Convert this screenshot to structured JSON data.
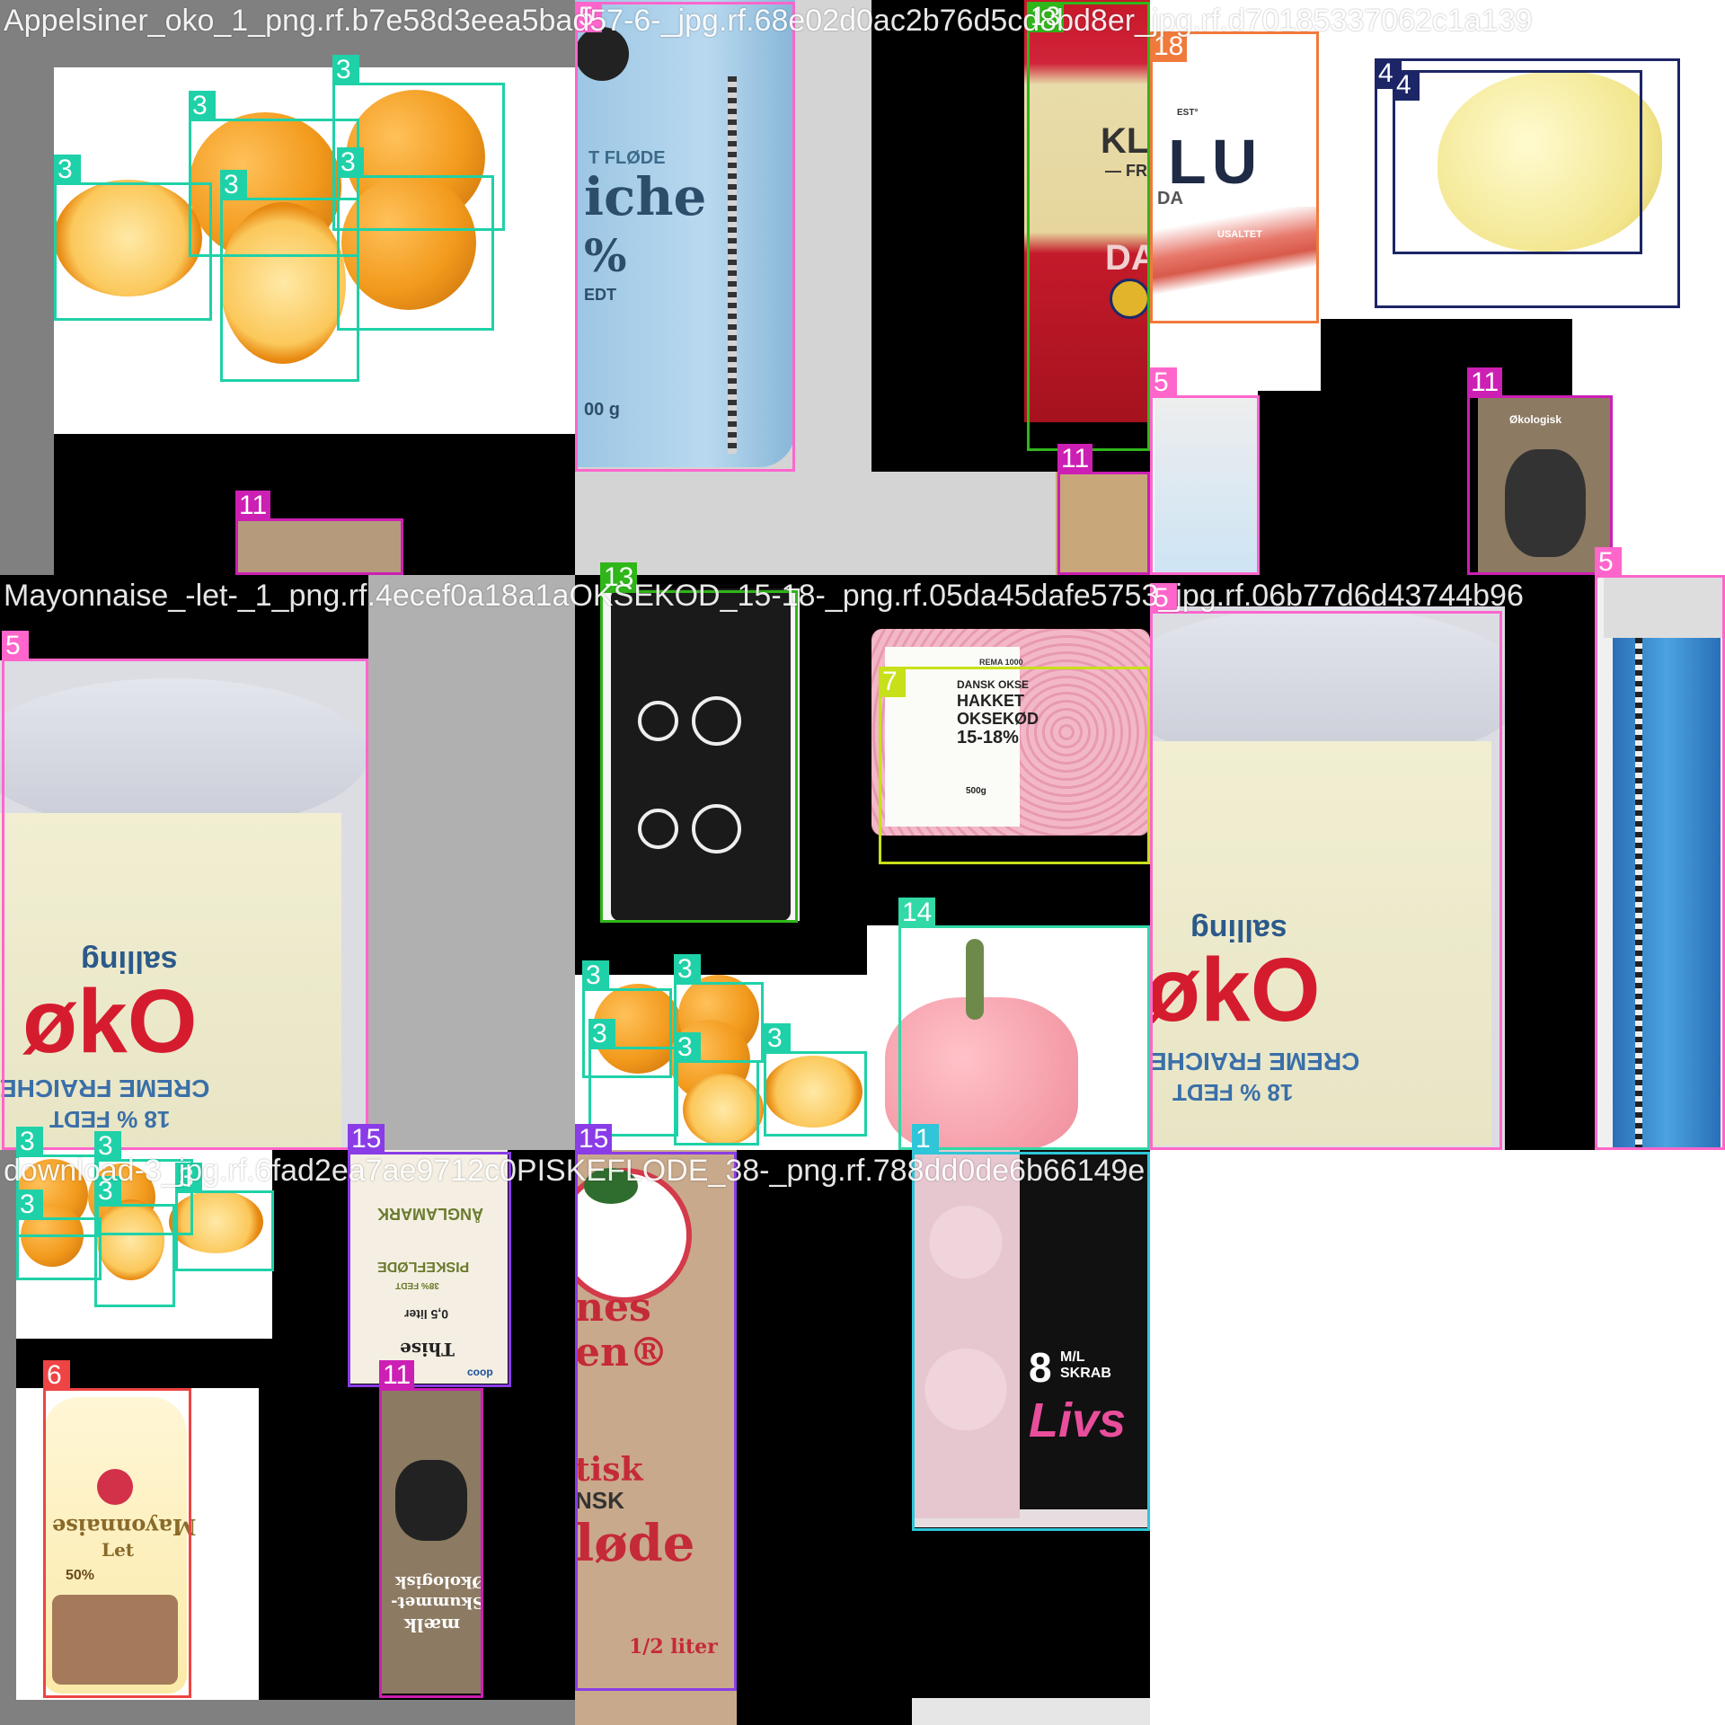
{
  "tiles": [
    {
      "id": "t1",
      "filename": "Appelsiner_oko_1_png.rf.b7e58d3eea5bad57-6-_jpg.rf.68e02d0ac2b76d5cd8bd8er_jpg.rf.d70185337062c1a139"
    },
    {
      "id": "t2",
      "filename": ""
    },
    {
      "id": "t3",
      "filename": ""
    },
    {
      "id": "t4",
      "filename": "Mayonnaise_-let-_1_png.rf.4ecef0a18a1aOKSEKOD_15-18-_png.rf.05da45dafe5753_jpg.rf.06b77d6d43744b96"
    },
    {
      "id": "t5",
      "filename": ""
    },
    {
      "id": "t6",
      "filename": ""
    },
    {
      "id": "t7",
      "filename": "download-3_jpg.rf.6fad2ea7ae9712c0PISKEFLODE_38-_png.rf.788dd0de6b66149e"
    },
    {
      "id": "t8",
      "filename": ""
    }
  ],
  "product_text": {
    "creme_t1": {
      "line1": "T FLØDE",
      "line2": "iche",
      "line3": "%",
      "line4": "EDT",
      "line5": "00 g"
    },
    "butter": {
      "brand": "LU",
      "est": "EST°",
      "da": "DA",
      "usaltet": "USALTET"
    },
    "cheese": {
      "brand": "KLO",
      "dash": "— FR",
      "da": "DA"
    },
    "oko_cream": {
      "brand": "salling",
      "oko": "økO",
      "line1": "CREME FRAICHE",
      "line2": "18 % FEDT"
    },
    "minced": {
      "line1": "DANSK OKSE",
      "line2": "HAKKET",
      "line3": "OKSEKØD",
      "line4": "15-18%",
      "weight": "500g",
      "brand": "REMA 1000"
    },
    "mayo": {
      "brand": "Mayonnaise",
      "sub": "Let",
      "pct": "50%"
    },
    "piskefl": {
      "brand": "ÅNGLAMARK",
      "sub": "PISKEFLØDE",
      "pct": "38% FEDT",
      "vol": "0,5 liter",
      "maker": "Thise",
      "shop": "coop"
    },
    "skummet": {
      "line1": "Økologisk",
      "line2": "Skummet-",
      "line3": "mælk"
    },
    "arla": {
      "line1": "nes",
      "line2": "en®",
      "line3": "tisk",
      "line4": "NSK",
      "line5": "løde",
      "vol": "1/2 liter"
    },
    "eggs": {
      "count": "8",
      "size": "M/L",
      "type": "SKRAB",
      "brand": "Livs"
    },
    "milk_small": {
      "line1": "Økologisk",
      "line2": "Skummetmælk"
    }
  },
  "boxes": [
    {
      "cls": "3",
      "color": "#1fd1a8"
    },
    {
      "cls": "5",
      "color": "#ff66cc"
    },
    {
      "cls": "13",
      "color": "#2fb619"
    },
    {
      "cls": "18",
      "color": "#f07a3c"
    },
    {
      "cls": "4",
      "color": "#1c2566"
    },
    {
      "cls": "11",
      "color": "#cc1fb4"
    },
    {
      "cls": "7",
      "color": "#c8e01a"
    },
    {
      "cls": "14",
      "color": "#30d9a6"
    },
    {
      "cls": "15",
      "color": "#8a3ce6"
    },
    {
      "cls": "6",
      "color": "#ee4444"
    },
    {
      "cls": "1",
      "color": "#2ec6d8"
    }
  ]
}
